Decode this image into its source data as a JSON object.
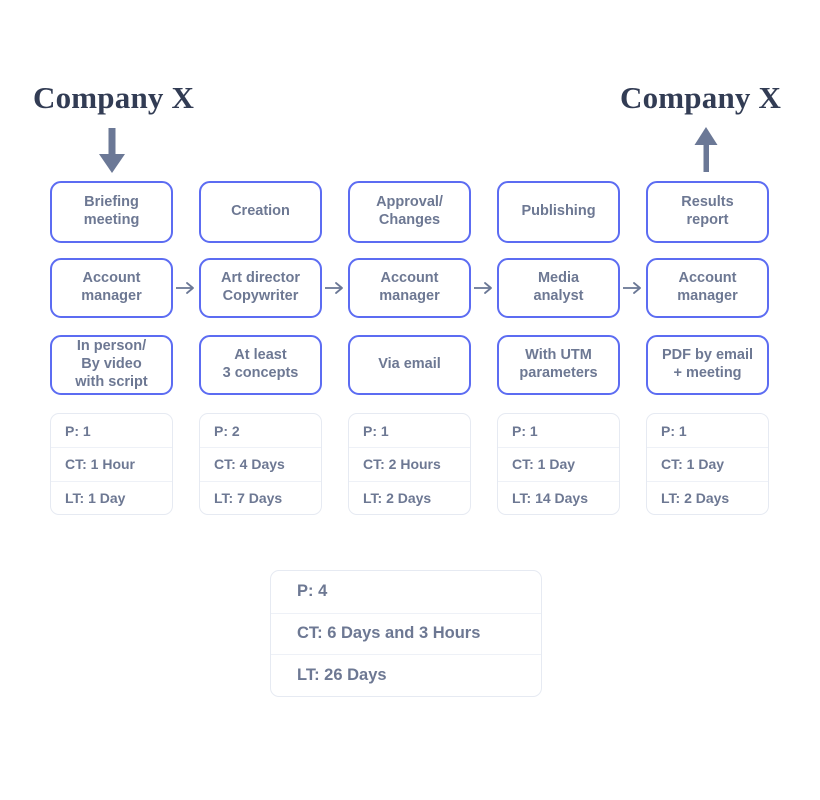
{
  "diagram": {
    "title_left": "Company X",
    "title_right": "Company X",
    "arrow_down_icon": "arrow-down-icon",
    "arrow_up_icon": "arrow-up-icon",
    "connector_icon": "arrow-right-icon",
    "accent_color": "#5c6cf2",
    "text_color": "#6d7893",
    "title_color": "#323c54",
    "card_border_color": "#e6eaf2",
    "arrow_color": "#6b7896"
  },
  "columns": [
    {
      "process": "Briefing\nmeeting",
      "role": "Account\nmanager",
      "detail": "In person/\nBy video\nwith script",
      "metrics": [
        "P: 1",
        "CT: 1 Hour",
        "LT: 1 Day"
      ]
    },
    {
      "process": "Creation",
      "role": "Art director\nCopywriter",
      "detail": "At least\n3 concepts",
      "metrics": [
        "P: 2",
        "CT: 4 Days",
        "LT: 7 Days"
      ]
    },
    {
      "process": "Approval/\nChanges",
      "role": "Account\nmanager",
      "detail": "Via email",
      "metrics": [
        "P: 1",
        "CT: 2 Hours",
        "LT: 2 Days"
      ]
    },
    {
      "process": "Publishing",
      "role": "Media\nanalyst",
      "detail": "With UTM\nparameters",
      "metrics": [
        "P: 1",
        "CT: 1 Day",
        "LT: 14 Days"
      ]
    },
    {
      "process": "Results\nreport",
      "role": "Account\nmanager",
      "detail": "PDF by email\n+ meeting",
      "metrics": [
        "P: 1",
        "CT: 1 Day",
        "LT: 2 Days"
      ]
    }
  ],
  "summary": {
    "rows": [
      "P: 4",
      "CT: 6 Days and 3 Hours",
      "LT: 26 Days"
    ]
  }
}
